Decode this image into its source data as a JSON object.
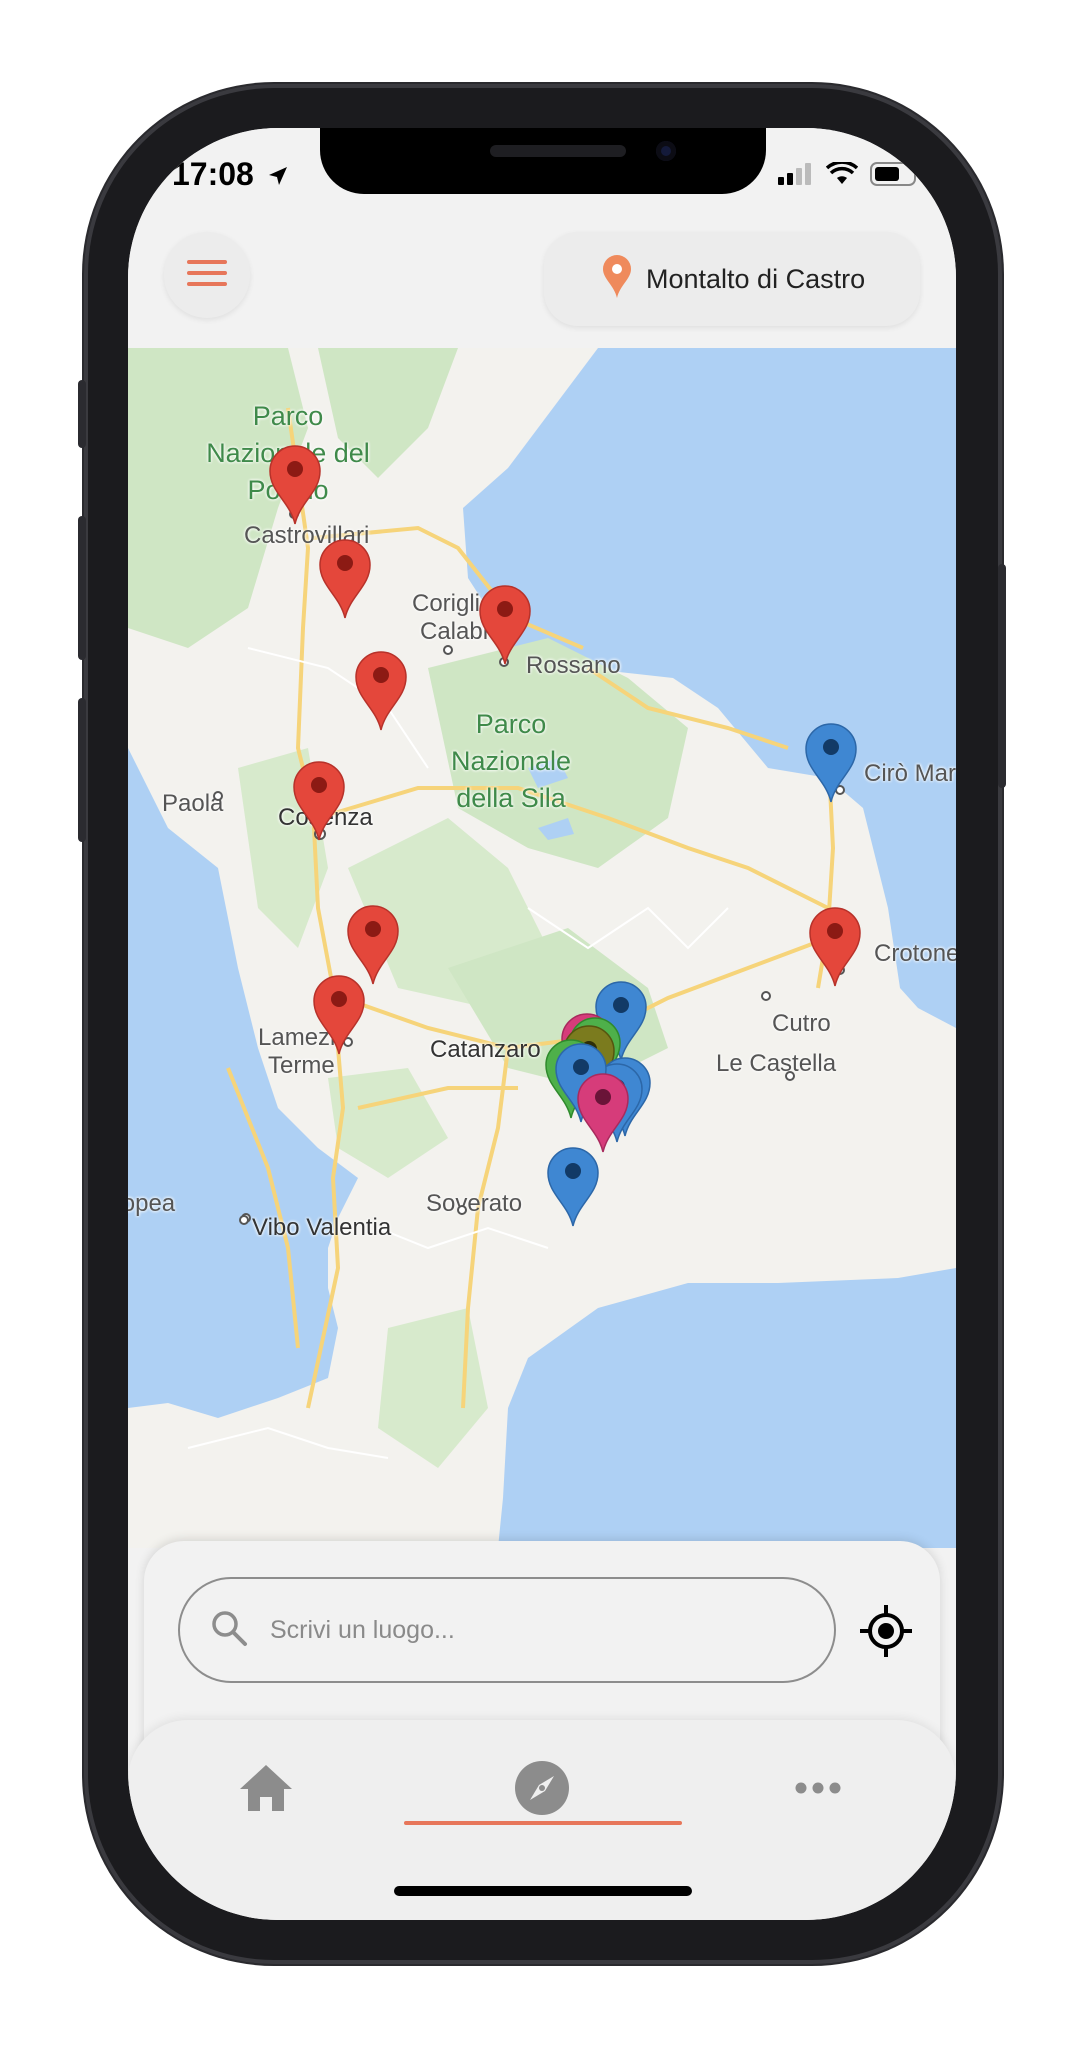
{
  "status_bar": {
    "time": "17:08"
  },
  "header": {
    "menu_icon": "hamburger-menu-icon",
    "location_label": "Montalto di Castro",
    "location_icon": "map-pin-icon"
  },
  "map": {
    "labels": {
      "castrovillari": "Castrovillari",
      "corigliano_1": "Corigliano",
      "corigliano_2": "Calabro",
      "rossano": "Rossano",
      "paola": "Paola",
      "cosenza": "Cosenza",
      "ciro": "Cirò Mar",
      "crotone": "Crotone",
      "cutro": "Cutro",
      "le_castella": "Le Castella",
      "lamezia_1": "Lamezia",
      "lamezia_2": "Terme",
      "catanzaro": "Catanzaro",
      "soverato": "Soverato",
      "tropea": "Tropea",
      "vibo": "Vibo Valentia"
    },
    "parks": {
      "pollino": "Parco Nazionale del Pollino",
      "sila": "Parco Nazionale della Sila"
    },
    "marker_colors": {
      "red": "#e4473b",
      "blue": "#3f87d2",
      "green": "#4eb04a",
      "olive": "#7b7b1e",
      "magenta": "#d63c7a"
    }
  },
  "search": {
    "placeholder": "Scrivi un luogo...",
    "gps_icon": "gps-target-icon",
    "search_icon": "search-icon"
  },
  "tabbar": {
    "items": [
      {
        "name": "home",
        "icon": "home-icon"
      },
      {
        "name": "explore",
        "icon": "compass-icon",
        "active": true
      },
      {
        "name": "more",
        "icon": "more-dots-icon"
      }
    ],
    "accent": "#e7765a"
  }
}
